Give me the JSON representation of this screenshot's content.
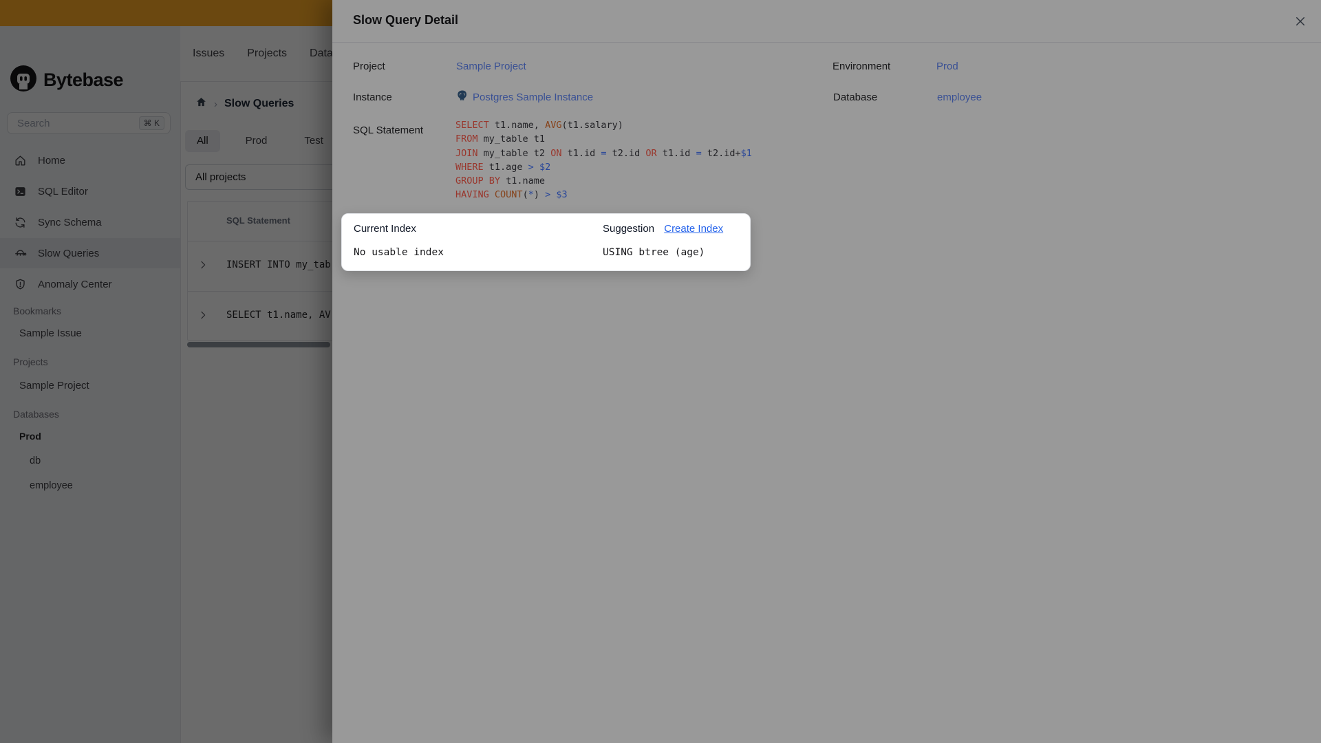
{
  "logo": {
    "text": "Bytebase"
  },
  "topnav": {
    "items": [
      {
        "label": "Issues"
      },
      {
        "label": "Projects"
      },
      {
        "label": "Databases"
      }
    ]
  },
  "sidebar": {
    "search": {
      "placeholder": "Search",
      "shortcut": "⌘ K"
    },
    "nav": [
      {
        "label": "Home",
        "icon": "home-icon",
        "active": false
      },
      {
        "label": "SQL Editor",
        "icon": "sql-editor-icon",
        "active": false
      },
      {
        "label": "Sync Schema",
        "icon": "sync-schema-icon",
        "active": false
      },
      {
        "label": "Slow Queries",
        "icon": "turtle-icon",
        "active": true
      },
      {
        "label": "Anomaly Center",
        "icon": "anomaly-shield-icon",
        "active": false
      }
    ],
    "sections": [
      {
        "title": "Bookmarks",
        "items": [
          "Sample Issue"
        ]
      },
      {
        "title": "Projects",
        "items": [
          "Sample Project"
        ]
      },
      {
        "title": "Databases",
        "items": []
      }
    ],
    "db_tree": {
      "environment": "Prod",
      "databases": [
        "db",
        "employee"
      ]
    }
  },
  "content": {
    "breadcrumb": {
      "title": "Slow Queries"
    },
    "tabs": [
      {
        "label": "All",
        "selected": true
      },
      {
        "label": "Prod",
        "selected": false
      },
      {
        "label": "Test",
        "selected": false
      }
    ],
    "filter": {
      "value": "All projects"
    },
    "table": {
      "header": "SQL Statement",
      "rows": [
        {
          "sql": "INSERT INTO my_tab"
        },
        {
          "sql": "SELECT t1.name, AV"
        }
      ]
    }
  },
  "modal": {
    "title": "Slow Query Detail",
    "rows": {
      "project_label": "Project",
      "project_value": "Sample Project",
      "environment_label": "Environment",
      "environment_value": "Prod",
      "instance_label": "Instance",
      "instance_value": "Postgres Sample Instance",
      "database_label": "Database",
      "database_value": "employee",
      "sql_label": "SQL Statement"
    },
    "sql_lines": [
      [
        {
          "c": "kw",
          "t": "SELECT"
        },
        {
          "c": "id",
          "t": " t1.name, "
        },
        {
          "c": "fn",
          "t": "AVG"
        },
        {
          "c": "id",
          "t": "(t1.salary)"
        }
      ],
      [
        {
          "c": "kw",
          "t": "FROM"
        },
        {
          "c": "id",
          "t": " my_table t1"
        }
      ],
      [
        {
          "c": "kw",
          "t": "JOIN"
        },
        {
          "c": "id",
          "t": " my_table t2 "
        },
        {
          "c": "kw",
          "t": "ON"
        },
        {
          "c": "id",
          "t": " t1.id "
        },
        {
          "c": "op",
          "t": "="
        },
        {
          "c": "id",
          "t": " t2.id "
        },
        {
          "c": "kw",
          "t": "OR"
        },
        {
          "c": "id",
          "t": " t1.id "
        },
        {
          "c": "op",
          "t": "="
        },
        {
          "c": "id",
          "t": " t2.id+"
        },
        {
          "c": "op",
          "t": "$1"
        }
      ],
      [
        {
          "c": "kw",
          "t": "WHERE"
        },
        {
          "c": "id",
          "t": " t1.age "
        },
        {
          "c": "op",
          "t": ">"
        },
        {
          "c": "id",
          "t": " "
        },
        {
          "c": "op",
          "t": "$2"
        }
      ],
      [
        {
          "c": "kw",
          "t": "GROUP BY"
        },
        {
          "c": "id",
          "t": " t1.name"
        }
      ],
      [
        {
          "c": "kw",
          "t": "HAVING"
        },
        {
          "c": "id",
          "t": " "
        },
        {
          "c": "fn",
          "t": "COUNT"
        },
        {
          "c": "id",
          "t": "("
        },
        {
          "c": "op",
          "t": "*"
        },
        {
          "c": "id",
          "t": ") "
        },
        {
          "c": "op",
          "t": ">"
        },
        {
          "c": "id",
          "t": " "
        },
        {
          "c": "op",
          "t": "$3"
        }
      ]
    ],
    "index_card": {
      "current_header": "Current Index",
      "current_value": "No usable index",
      "suggestion_header": "Suggestion",
      "suggestion_link": "Create Index",
      "suggestion_value": "USING btree (age)"
    }
  },
  "colors": {
    "banner": "#ffae28",
    "link": "#5f85f7",
    "card_link": "#2563eb",
    "sql_keyword": "#ff5a4a",
    "sql_function": "#e0702e",
    "sql_operator": "#4375ff",
    "sql_identifier": "#3a3a40"
  }
}
